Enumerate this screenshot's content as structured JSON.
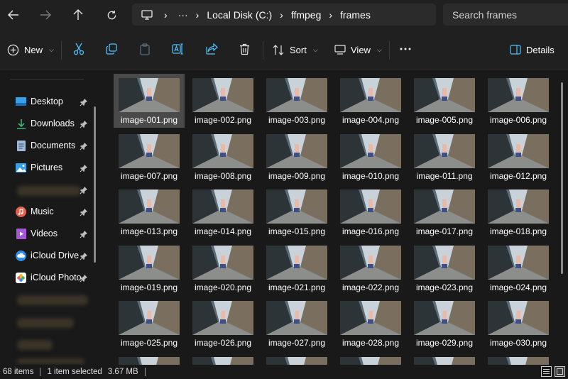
{
  "nav": {
    "breadcrumb": [
      "Local Disk (C:)",
      "ffmpeg",
      "frames"
    ],
    "overflow": "···",
    "search_placeholder": "Search frames"
  },
  "toolbar": {
    "new_label": "New",
    "sort_label": "Sort",
    "view_label": "View",
    "details_label": "Details"
  },
  "sidebar": {
    "items": [
      {
        "label": "Desktop"
      },
      {
        "label": "Downloads"
      },
      {
        "label": "Documents"
      },
      {
        "label": "Pictures"
      },
      {
        "label": "Music"
      },
      {
        "label": "Videos"
      },
      {
        "label": "iCloud Drive"
      },
      {
        "label": "iCloud Photo"
      }
    ]
  },
  "files": [
    "image-001.png",
    "image-002.png",
    "image-003.png",
    "image-004.png",
    "image-005.png",
    "image-006.png",
    "image-007.png",
    "image-008.png",
    "image-009.png",
    "image-010.png",
    "image-011.png",
    "image-012.png",
    "image-013.png",
    "image-014.png",
    "image-015.png",
    "image-016.png",
    "image-017.png",
    "image-018.png",
    "image-019.png",
    "image-020.png",
    "image-021.png",
    "image-022.png",
    "image-023.png",
    "image-024.png",
    "image-025.png",
    "image-026.png",
    "image-027.png",
    "image-028.png",
    "image-029.png",
    "image-030.png"
  ],
  "selected_file": "image-001.png",
  "status": {
    "item_count": "68 items",
    "selection": "1 item selected",
    "size": "3.67 MB"
  },
  "colors": {
    "accent_blue": "#4cc2ff",
    "selected_tile": "#4a4a4a",
    "background": "#191919"
  }
}
